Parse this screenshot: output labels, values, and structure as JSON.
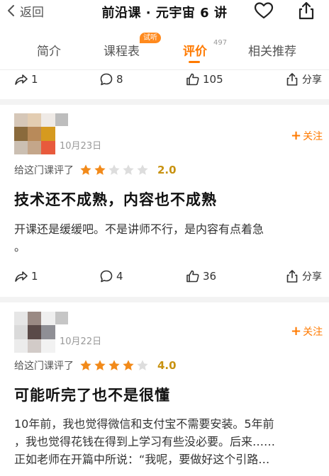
{
  "header": {
    "back_label": "返回",
    "title": "前沿课 · 元宇宙 6 讲"
  },
  "tabs": {
    "intro": "简介",
    "schedule": "课程表",
    "trial_badge": "试听",
    "reviews": "评价",
    "review_count": "497",
    "related": "相关推荐",
    "active": "reviews"
  },
  "top_actions": {
    "shares": "1",
    "comments": "8",
    "likes": "105",
    "share_label": "分享"
  },
  "reviews": [
    {
      "date": "10月23日",
      "follow_label": "关注",
      "rating_label": "给这门课评了",
      "stars": 2,
      "score": "2.0",
      "headline": "技术还不成熟，内容也不成熟",
      "body_line1": "开课还是缓缓吧。不是讲师不行，是内容有点着急",
      "body_line2": "。",
      "shares": "1",
      "comments": "4",
      "likes": "36",
      "share_label": "分享"
    },
    {
      "date": "10月22日",
      "follow_label": "关注",
      "rating_label": "给这门课评了",
      "stars": 4,
      "score": "4.0",
      "headline": "可能听完了也不是很懂",
      "body_line1": "10年前，我也觉得微信和支付宝不需要安装。5年前",
      "body_line2": "，我也觉得花钱在得到上学习有些没必要。后来……",
      "body_line3": "正如老师在开篇中所说：“我呢，要做好这个引路…"
    }
  ],
  "colors": {
    "accent": "#ff7a00",
    "star_filled": "#f28a1a",
    "star_empty": "#dddddd",
    "score": "#c89211"
  }
}
